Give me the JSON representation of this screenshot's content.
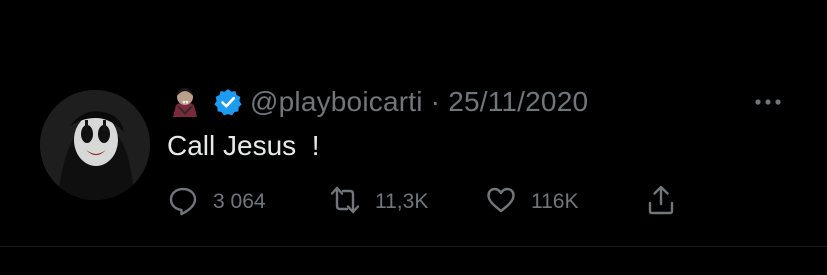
{
  "tweet": {
    "handle": "@playboicarti",
    "separator": "·",
    "date": "25/11/2020",
    "text": "Call Jesus  !",
    "actions": {
      "reply_count": "3 064",
      "retweet_count": "11,3K",
      "like_count": "116K"
    }
  },
  "icons": {
    "emoji": "vampire-emoji-icon",
    "verified": "verified-badge-icon",
    "more": "more-options-icon",
    "reply": "reply-icon",
    "retweet": "retweet-icon",
    "like": "heart-icon",
    "share": "share-icon"
  },
  "colors": {
    "background": "#000000",
    "text_primary": "#e7e9ea",
    "text_secondary": "#71767b",
    "verified_blue": "#1d9bf0"
  }
}
